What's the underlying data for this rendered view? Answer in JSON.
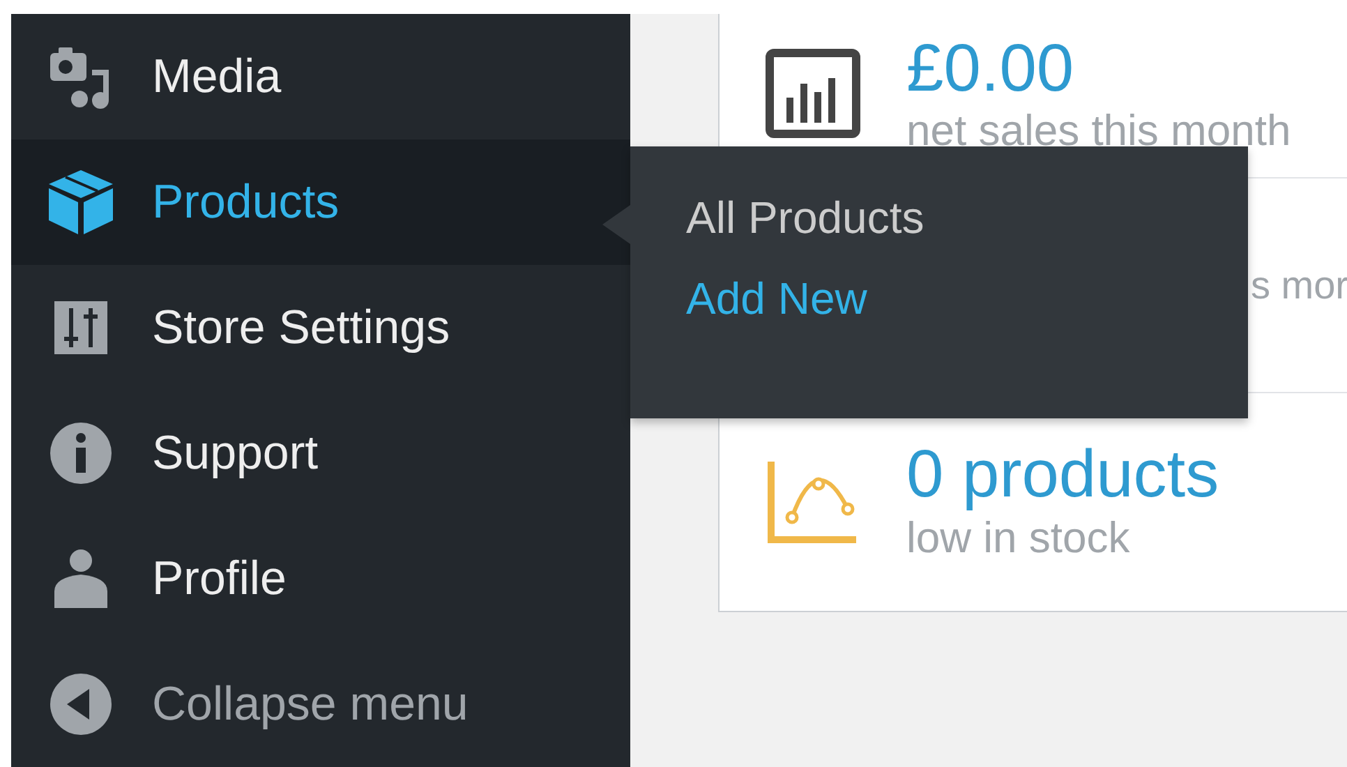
{
  "menu": [
    {
      "label": "Media",
      "kind": "media",
      "selected": false
    },
    {
      "label": "Products",
      "kind": "box",
      "selected": true
    },
    {
      "label": "Store Settings",
      "kind": "sliders",
      "selected": false
    },
    {
      "label": "Support",
      "kind": "info",
      "selected": false
    },
    {
      "label": "Profile",
      "kind": "person",
      "selected": false
    }
  ],
  "collapse": {
    "label": "Collapse menu"
  },
  "submenu": [
    {
      "label": "All Products",
      "selected": false
    },
    {
      "label": "Add New",
      "selected": true
    }
  ],
  "stats": [
    {
      "kind": "sales",
      "value": "£0.00",
      "label": "net sales this month"
    },
    {
      "kind": "partial",
      "label": "s mor"
    },
    {
      "kind": "stock",
      "value": "0 products",
      "label": "low in stock"
    }
  ]
}
